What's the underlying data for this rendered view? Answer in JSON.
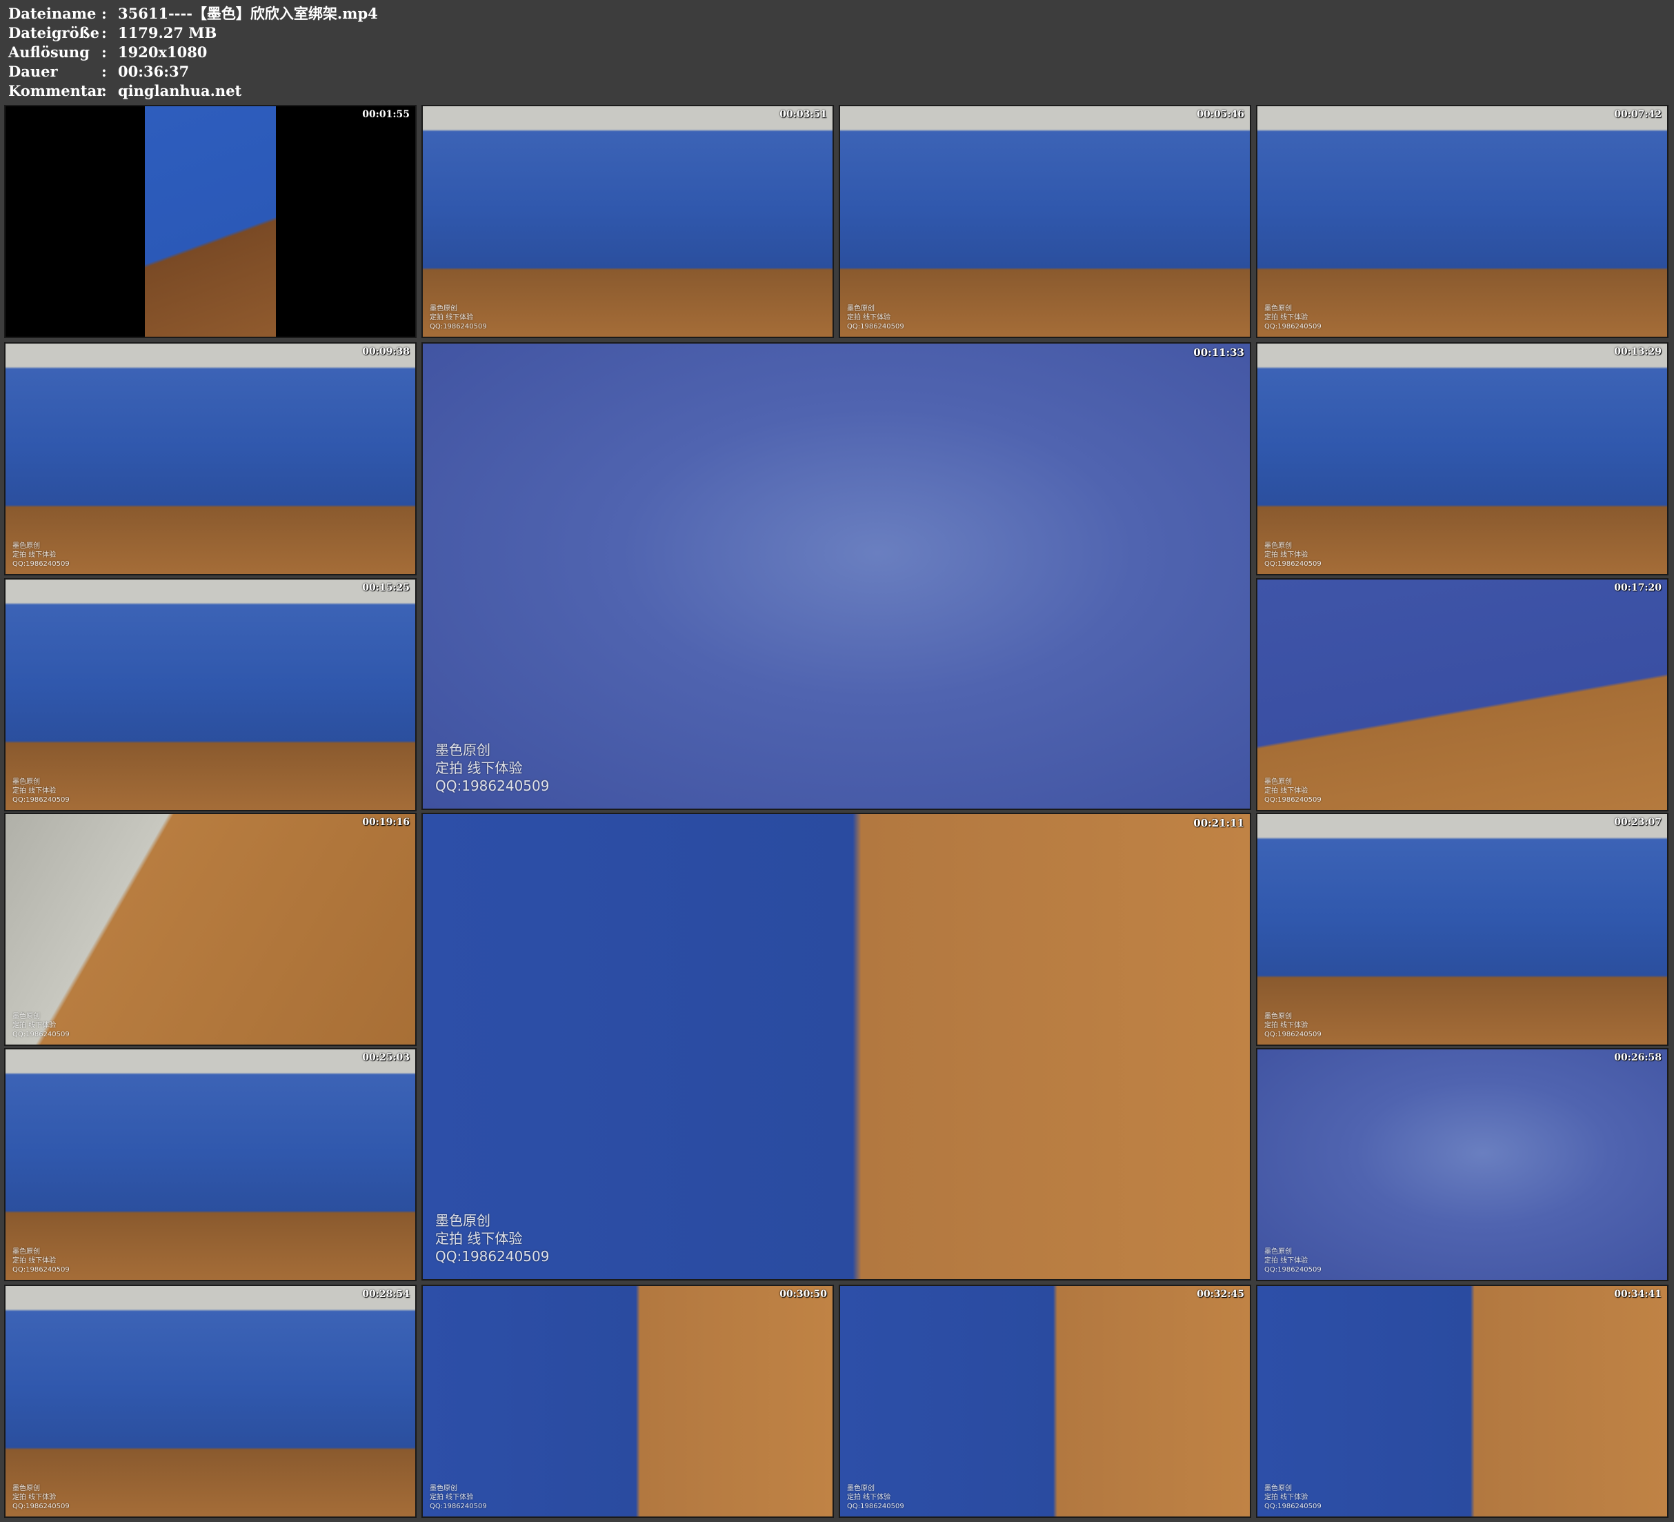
{
  "info": [
    {
      "label": "Dateiname",
      "value": "35611----【墨色】欣欣入室绑架.mp4"
    },
    {
      "label": "Dateigröße",
      "value": "1179.27 MB"
    },
    {
      "label": "Auflösung",
      "value": "1920x1080"
    },
    {
      "label": "Dauer",
      "value": "00:36:37"
    },
    {
      "label": "Kommentar",
      "value": "qinglanhua.net"
    }
  ],
  "separator": ":",
  "watermark": {
    "line1": "墨色原创",
    "line2": "定拍 线下体验",
    "line3": "QQ:1986240509"
  },
  "frames": [
    {
      "time": "00:01:55"
    },
    {
      "time": "00:03:51"
    },
    {
      "time": "00:05:46"
    },
    {
      "time": "00:07:42"
    },
    {
      "time": "00:09:38"
    },
    {
      "time": "00:11:33"
    },
    {
      "time": "00:13:29"
    },
    {
      "time": "00:15:25"
    },
    {
      "time": "00:17:20"
    },
    {
      "time": "00:19:16"
    },
    {
      "time": "00:21:11"
    },
    {
      "time": "00:23:07"
    },
    {
      "time": "00:25:03"
    },
    {
      "time": "00:26:58"
    },
    {
      "time": "00:28:54"
    },
    {
      "time": "00:30:50"
    },
    {
      "time": "00:32:45"
    },
    {
      "time": "00:34:41"
    }
  ]
}
